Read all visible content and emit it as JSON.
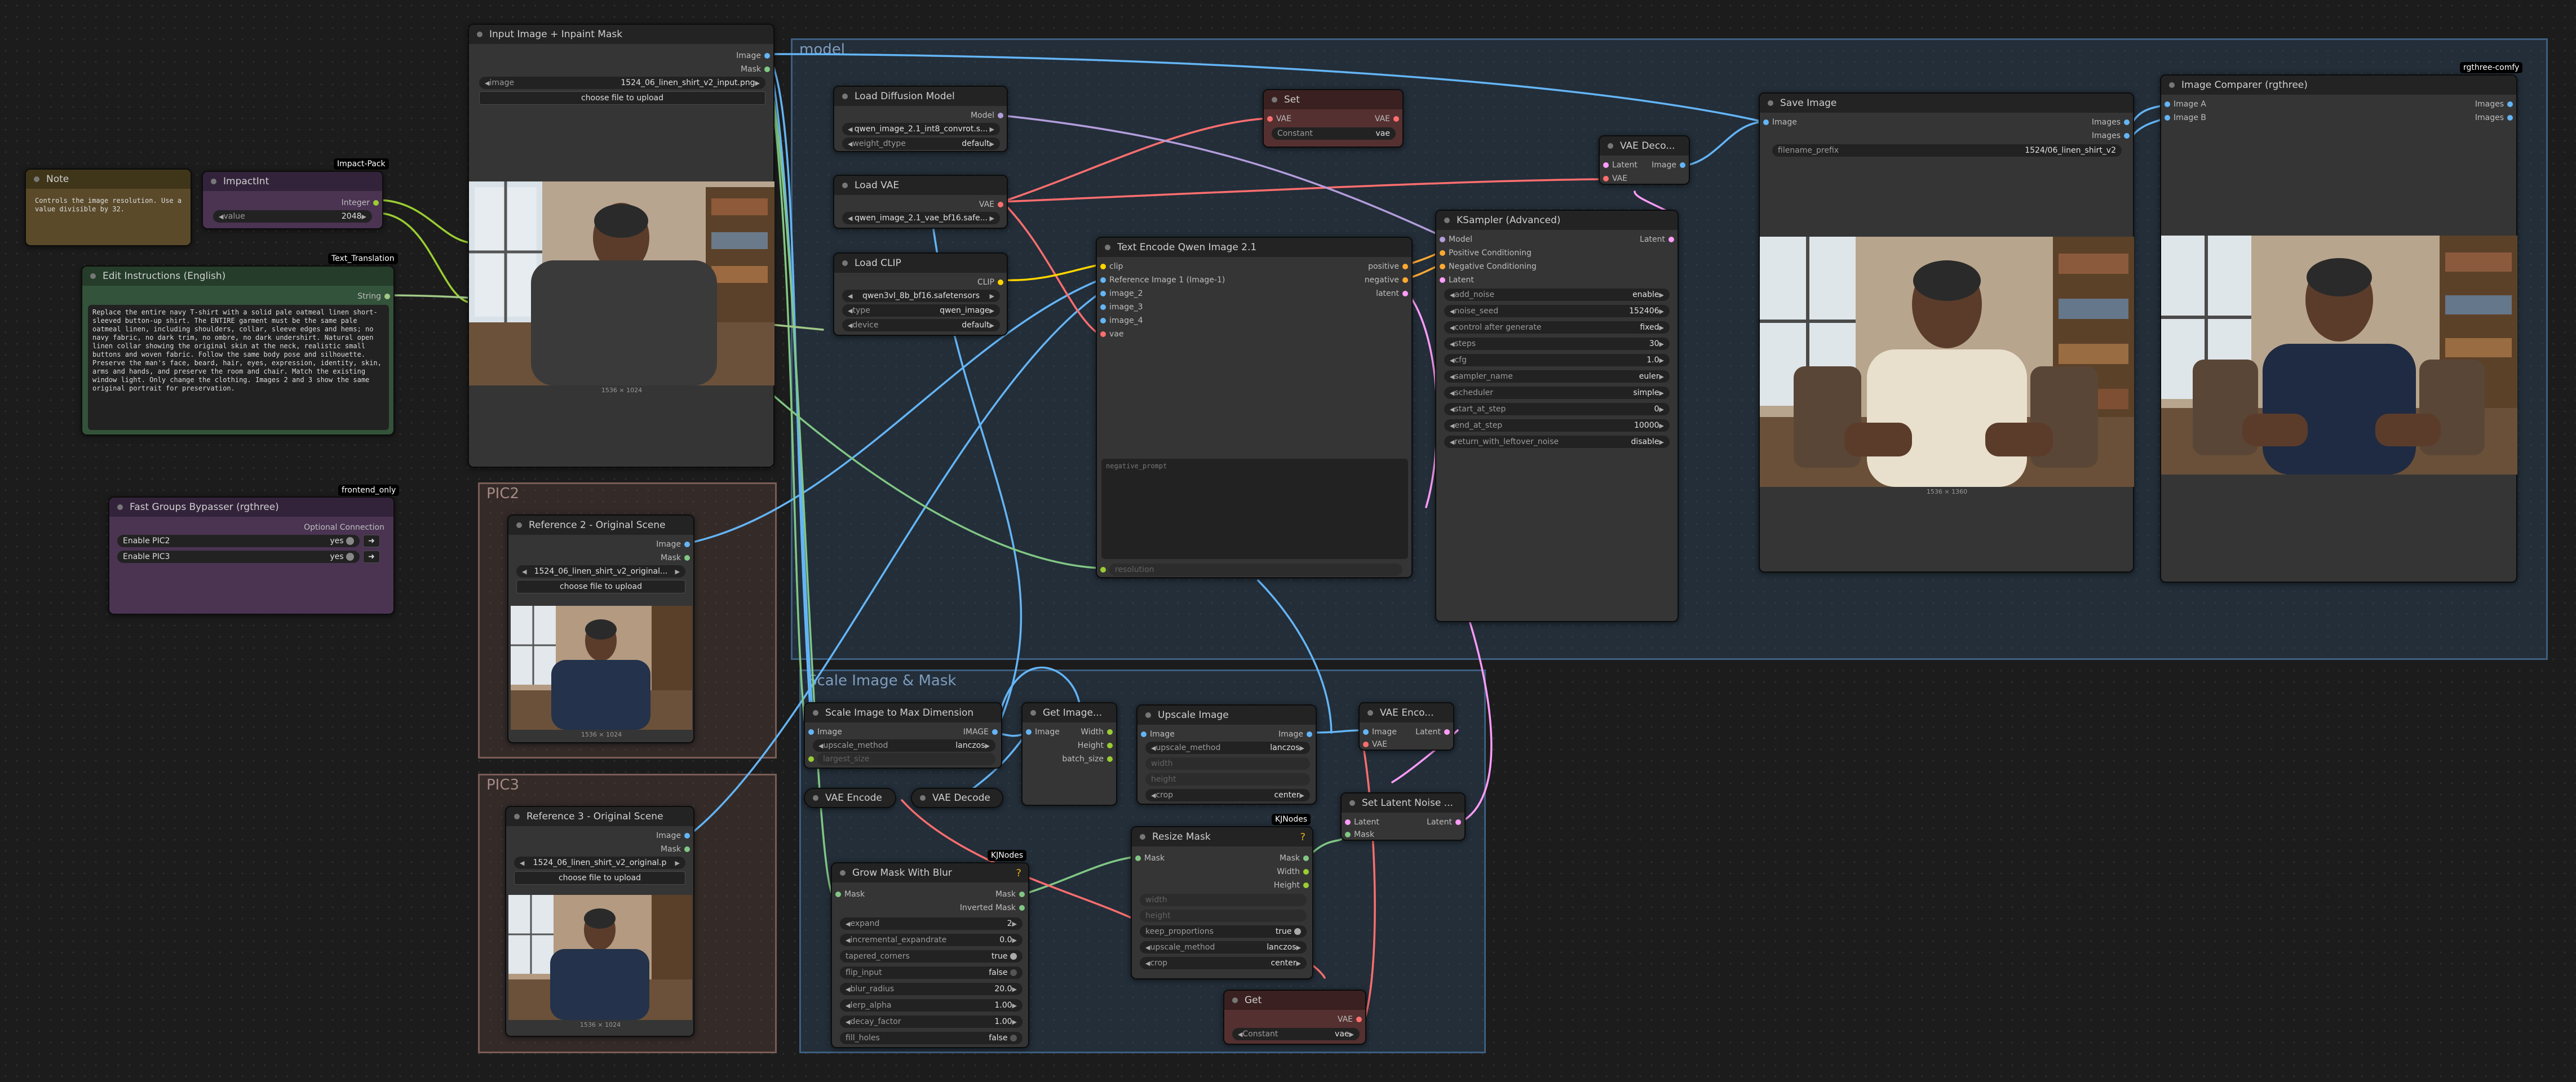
{
  "groups": {
    "model": "model",
    "scale": "Scale Image & Mask",
    "pic2": "PIC2",
    "pic3": "PIC3"
  },
  "badges": {
    "rgthree_comfy": "rgthree-comfy",
    "impact_pack": "Impact-Pack",
    "text_translation": "Text_Translation",
    "frontend_only": "frontend_only",
    "kjnodes_a": "KJNodes",
    "kjnodes_b": "KJNodes"
  },
  "note": {
    "title": "Note",
    "text": "Controls the image resolution. Use a value divisible by 32."
  },
  "impactint": {
    "title": "ImpactInt",
    "out": "Integer",
    "w_label": "value",
    "w_value": "2048"
  },
  "edit_instr": {
    "title": "Edit Instructions (English)",
    "out": "String",
    "text": "Replace the entire navy T-shirt with a solid pale oatmeal linen short-sleeved button-up shirt. The ENTIRE garment must be the same pale oatmeal linen, including shoulders, collar, sleeve edges and hems; no navy fabric, no dark trim, no ombre, no dark undershirt. Natural open linen collar showing the original skin at the neck, realistic small buttons and woven fabric. Follow the same body pose and silhouette. Preserve the man's face, beard, hair, eyes, expression, identity, skin, arms and hands, and preserve the room and chair. Match the existing window light. Only change the clothing. Images 2 and 3 show the same original portrait for preservation."
  },
  "bypasser": {
    "title": "Fast Groups Bypasser (rgthree)",
    "opt": "Optional Connection",
    "items": [
      {
        "label": "Enable PIC2",
        "state": "yes"
      },
      {
        "label": "Enable PIC3",
        "state": "yes"
      }
    ]
  },
  "input_img": {
    "title": "Input Image + Inpaint Mask",
    "out_image": "Image",
    "out_mask": "Mask",
    "w_label": "image",
    "w_value": "1524_06_linen_shirt_v2_input.png",
    "upload": "choose file to upload",
    "dims": "1536 × 1024"
  },
  "ref2": {
    "title": "Reference 2 - Original Scene",
    "out_image": "Image",
    "out_mask": "Mask",
    "w_label": "",
    "w_value": "1524_06_linen_shirt_v2_original...",
    "upload": "choose file to upload",
    "dims": "1536 × 1024"
  },
  "ref3": {
    "title": "Reference 3 - Original Scene",
    "out_image": "Image",
    "out_mask": "Mask",
    "w_label": "",
    "w_value": "1524_06_linen_shirt_v2_original.p",
    "upload": "choose file to upload",
    "dims": "1536 × 1024"
  },
  "load_diff": {
    "title": "Load Diffusion Model",
    "out": "Model",
    "w1": "qwen_image_2.1_int8_convrot.s...",
    "w2_label": "weight_dtype",
    "w2_value": "default"
  },
  "load_vae": {
    "title": "Load VAE",
    "out": "VAE",
    "w1": "qwen_image_2.1_vae_bf16.safe..."
  },
  "load_clip": {
    "title": "Load CLIP",
    "out": "CLIP",
    "w1": "qwen3vl_8b_bf16.safetensors",
    "w2_label": "type",
    "w2_value": "qwen_image",
    "w3_label": "device",
    "w3_value": "default"
  },
  "set": {
    "title": "Set",
    "in": "VAE",
    "out": "VAE",
    "w_label": "Constant",
    "w_value": "vae"
  },
  "text_enc": {
    "title": "Text Encode Qwen Image 2.1",
    "in": [
      "clip",
      "Reference Image 1 (Image-1)",
      "image_2",
      "image_3",
      "image_4",
      "vae"
    ],
    "out": [
      "positive",
      "negative",
      "latent"
    ],
    "neg": "negative_prompt",
    "resolution": "resolution"
  },
  "vae_dec_top": {
    "title": "VAE Deco...",
    "in": [
      "Latent",
      "VAE"
    ],
    "out": "Image"
  },
  "ksampler": {
    "title": "KSampler (Advanced)",
    "in": [
      "Model",
      "Positive Conditioning",
      "Negative Conditioning",
      "Latent"
    ],
    "out": "Latent",
    "widgets": [
      {
        "l": "add_noise",
        "v": "enable"
      },
      {
        "l": "noise_seed",
        "v": "152406"
      },
      {
        "l": "control after generate",
        "v": "fixed"
      },
      {
        "l": "steps",
        "v": "30"
      },
      {
        "l": "cfg",
        "v": "1.0"
      },
      {
        "l": "sampler_name",
        "v": "euler"
      },
      {
        "l": "scheduler",
        "v": "simple"
      },
      {
        "l": "start_at_step",
        "v": "0"
      },
      {
        "l": "end_at_step",
        "v": "10000"
      },
      {
        "l": "return_with_leftover_noise",
        "v": "disable"
      }
    ]
  },
  "save": {
    "title": "Save Image",
    "in": "Image",
    "out": [
      "Images",
      "Images"
    ],
    "w_label": "filename_prefix",
    "w_value": "1524/06_linen_shirt_v2",
    "dims": "1536 × 1360"
  },
  "comparer": {
    "title": "Image Comparer (rgthree)",
    "in": [
      "Image A",
      "Image B"
    ],
    "out": [
      "Images",
      "Images"
    ]
  },
  "scale_max": {
    "title": "Scale Image to Max Dimension",
    "in": "Image",
    "out": "IMAGE",
    "w1_label": "upscale_method",
    "w1_value": "lanczos",
    "w2": "largest_size"
  },
  "get_image": {
    "title": "Get Image...",
    "in": "Image",
    "out": [
      "Width",
      "Height",
      "batch_size"
    ]
  },
  "upscale": {
    "title": "Upscale Image",
    "in": "Image",
    "out": "Image",
    "widgets": [
      {
        "l": "upscale_method",
        "v": "lanczos"
      },
      {
        "l": "width",
        "v": ""
      },
      {
        "l": "height",
        "v": ""
      },
      {
        "l": "crop",
        "v": "center"
      }
    ]
  },
  "vae_enc_small": {
    "title": "VAE Enco...",
    "in": [
      "Image",
      "VAE"
    ],
    "out": "Latent"
  },
  "vae_encode": {
    "title": "VAE Encode"
  },
  "vae_decode": {
    "title": "VAE Decode"
  },
  "set_latent": {
    "title": "Set Latent Noise ...",
    "in": [
      "Latent",
      "Mask"
    ],
    "out": "Latent"
  },
  "resize_mask": {
    "title": "Resize Mask",
    "in": "Mask",
    "out": [
      "Mask",
      "Width",
      "Height"
    ],
    "widgets": [
      {
        "l": "width",
        "v": ""
      },
      {
        "l": "height",
        "v": ""
      },
      {
        "l": "keep_proportions",
        "v": "true"
      },
      {
        "l": "upscale_method",
        "v": "lanczos"
      },
      {
        "l": "crop",
        "v": "center"
      }
    ]
  },
  "grow_mask": {
    "title": "Grow Mask With Blur",
    "in": "Mask",
    "out": [
      "Mask",
      "Inverted Mask"
    ],
    "widgets": [
      {
        "l": "expand",
        "v": "2"
      },
      {
        "l": "incremental_expandrate",
        "v": "0.0"
      },
      {
        "l": "tapered_corners",
        "v": "true"
      },
      {
        "l": "flip_input",
        "v": "false"
      },
      {
        "l": "blur_radius",
        "v": "20.0"
      },
      {
        "l": "lerp_alpha",
        "v": "1.00"
      },
      {
        "l": "decay_factor",
        "v": "1.00"
      },
      {
        "l": "fill_holes",
        "v": "false"
      }
    ]
  },
  "get": {
    "title": "Get",
    "out": "VAE",
    "w_label": "Constant",
    "w_value": "vae"
  },
  "colors": {
    "image": "#64b5f6",
    "mask": "#81c784",
    "vae": "#ff6e6e",
    "latent": "#ff9cf9",
    "clip": "#ffd500",
    "cond": "#ffa931",
    "int": "#9acd32",
    "string": "#a1c887",
    "model": "#b39ddb"
  }
}
